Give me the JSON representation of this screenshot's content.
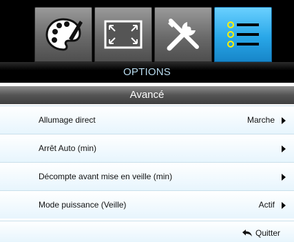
{
  "tabs": [
    {
      "icon": "palette-icon",
      "active": false
    },
    {
      "icon": "screen-resize-icon",
      "active": false
    },
    {
      "icon": "tools-icon",
      "active": false
    },
    {
      "icon": "list-menu-icon",
      "active": true
    }
  ],
  "header": {
    "title": "OPTIONS"
  },
  "submenu": {
    "title": "Avancé"
  },
  "menu_items": [
    {
      "label": "Allumage direct",
      "value": "Marche"
    },
    {
      "label": "Arrêt Auto (min)",
      "value": ""
    },
    {
      "label": "Décompte avant mise en veille (min)",
      "value": ""
    },
    {
      "label": "Mode puissance (Veille)",
      "value": "Actif"
    }
  ],
  "footer": {
    "quit_label": "Quitter",
    "quit_icon": "return-arrow-icon"
  },
  "colors": {
    "active_tab": "#29a7e8",
    "header_text": "#b9dcef",
    "row_bg": "#e7f5fd"
  }
}
